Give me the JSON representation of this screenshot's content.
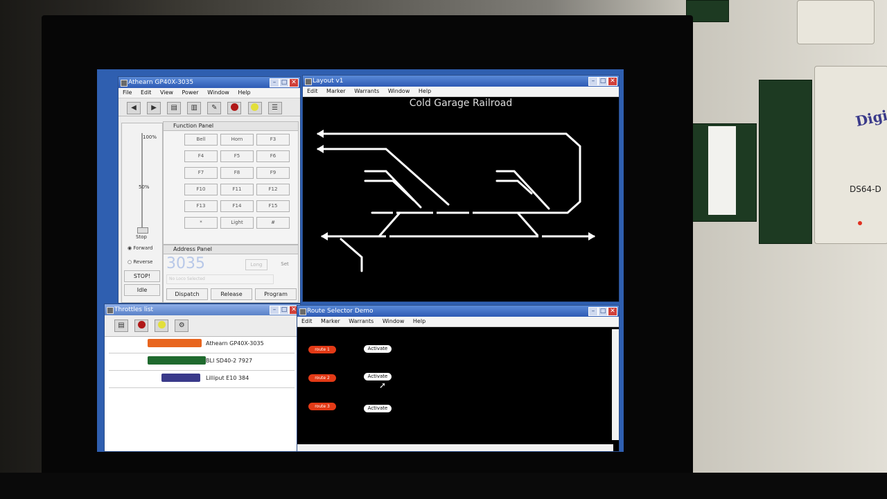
{
  "throttle_window": {
    "title": "Athearn GP40X-3035",
    "menu": [
      "File",
      "Edit",
      "View",
      "Power",
      "Window",
      "Help"
    ],
    "speed_labels": {
      "top": "100%",
      "mid": "50%"
    },
    "direction": {
      "stop": "Stop",
      "forward": "Forward",
      "reverse": "Reverse"
    },
    "stop_button": "STOP!",
    "idle_button": "Idle",
    "function_panel_title": "Function Panel",
    "functions": [
      "Bell",
      "Horn",
      "F3",
      "F4",
      "F5",
      "F6",
      "F7",
      "F8",
      "F9",
      "F10",
      "F11",
      "F12",
      "F13",
      "F14",
      "F15",
      "*",
      "Light",
      "#"
    ],
    "address_panel_title": "Address Panel",
    "address_value": "3035",
    "address_type": "Long",
    "set_button": "Set",
    "roster_placeholder": "No Loco Selected",
    "dispatch_button": "Dispatch",
    "release_button": "Release",
    "program_button": "Program"
  },
  "layout_window": {
    "title": "Layout v1",
    "menu": [
      "Edit",
      "Marker",
      "Warrants",
      "Window",
      "Help"
    ],
    "panel_title": "Cold Garage Railroad"
  },
  "throttles_list": {
    "title": "Throttles list",
    "items": [
      {
        "label": "Athearn GP40X-3035",
        "color": "#e8651e"
      },
      {
        "label": "BLI SD40-2 7927",
        "color": "#1f6a2e"
      },
      {
        "label": "Lilliput E10 384",
        "color": "#3a3a8a"
      }
    ]
  },
  "route_window": {
    "title": "Route Selector Demo",
    "menu": [
      "Edit",
      "Marker",
      "Warrants",
      "Window",
      "Help"
    ],
    "routes": [
      {
        "label": "route 1",
        "button": "Activate"
      },
      {
        "label": "route 2",
        "button": "Activate"
      },
      {
        "label": "route 3",
        "button": "Activate"
      }
    ]
  },
  "hardware": {
    "brand": "Digitrax",
    "model": "DS64-D"
  }
}
